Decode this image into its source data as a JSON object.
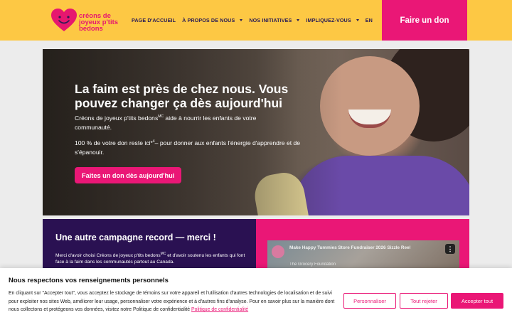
{
  "colors": {
    "header_bg": "#fdc844",
    "accent": "#ea1776",
    "navy": "#2a1c55",
    "campaign_bg": "#2a1152"
  },
  "logo": {
    "line1": "créons de",
    "line2": "joyeux p'tits",
    "line3": "bedons",
    "icon": "heart-smile-icon"
  },
  "nav": {
    "items": [
      {
        "label": "PAGE D'ACCUEIL",
        "dropdown": false
      },
      {
        "label": "À PROPOS DE NOUS",
        "dropdown": true
      },
      {
        "label": "NOS INITIATIVES",
        "dropdown": true
      },
      {
        "label": "IMPLIQUEZ-VOUS",
        "dropdown": true
      },
      {
        "label": "EN",
        "dropdown": false
      }
    ],
    "donate_label": "Faire un don"
  },
  "hero": {
    "title": "La faim est près de chez nous. Vous pouvez changer ça dès aujourd'hui",
    "p1_a": "Créons de joyeux p'tits bedons",
    "p1_sup": "MC",
    "p1_b": " aide à nourrir les enfants de votre communauté.",
    "p2_a": "100 % de votre don reste ici*",
    "p2_sup": "4",
    "p2_b": "– pour donner aux enfants l'énergie d'apprendre et de s'épanouir.",
    "cta": "Faites un don dès aujourd'hui"
  },
  "campaign": {
    "title": "Une autre campagne record — merci !",
    "text_a": "Merci d'avoir choisi Créons de joyeux p'tits bedons",
    "text_sup": "MC",
    "text_b": " et d'avoir soutenu les enfants qui font face à la faim dans les communautés partout au Canada.",
    "video": {
      "title": "Make Happy Tummies Store Fundraiser 2026 Sizzle Reel",
      "channel": "The Grocery Foundation",
      "menu": "⋮"
    }
  },
  "cookie": {
    "title": "Nous respectons vos renseignements personnels",
    "text": "En cliquant sur \"Accepter tout\", vous acceptez le stockage de témoins sur votre appareil et l'utilisation d'autres technologies de localisation et de suivi pour exploiter nos sites Web, améliorer leur usage, personnaliser votre expérience et à d'autres fins d'analyse. Pour en savoir plus sur la manière dont nous collectons et protégeons vos données, visitez notre Politique de confidentialité ",
    "link": "Politique de confidentialité",
    "personalize": "Personnaliser",
    "reject": "Tout rejeter",
    "accept": "Accepter tout"
  }
}
